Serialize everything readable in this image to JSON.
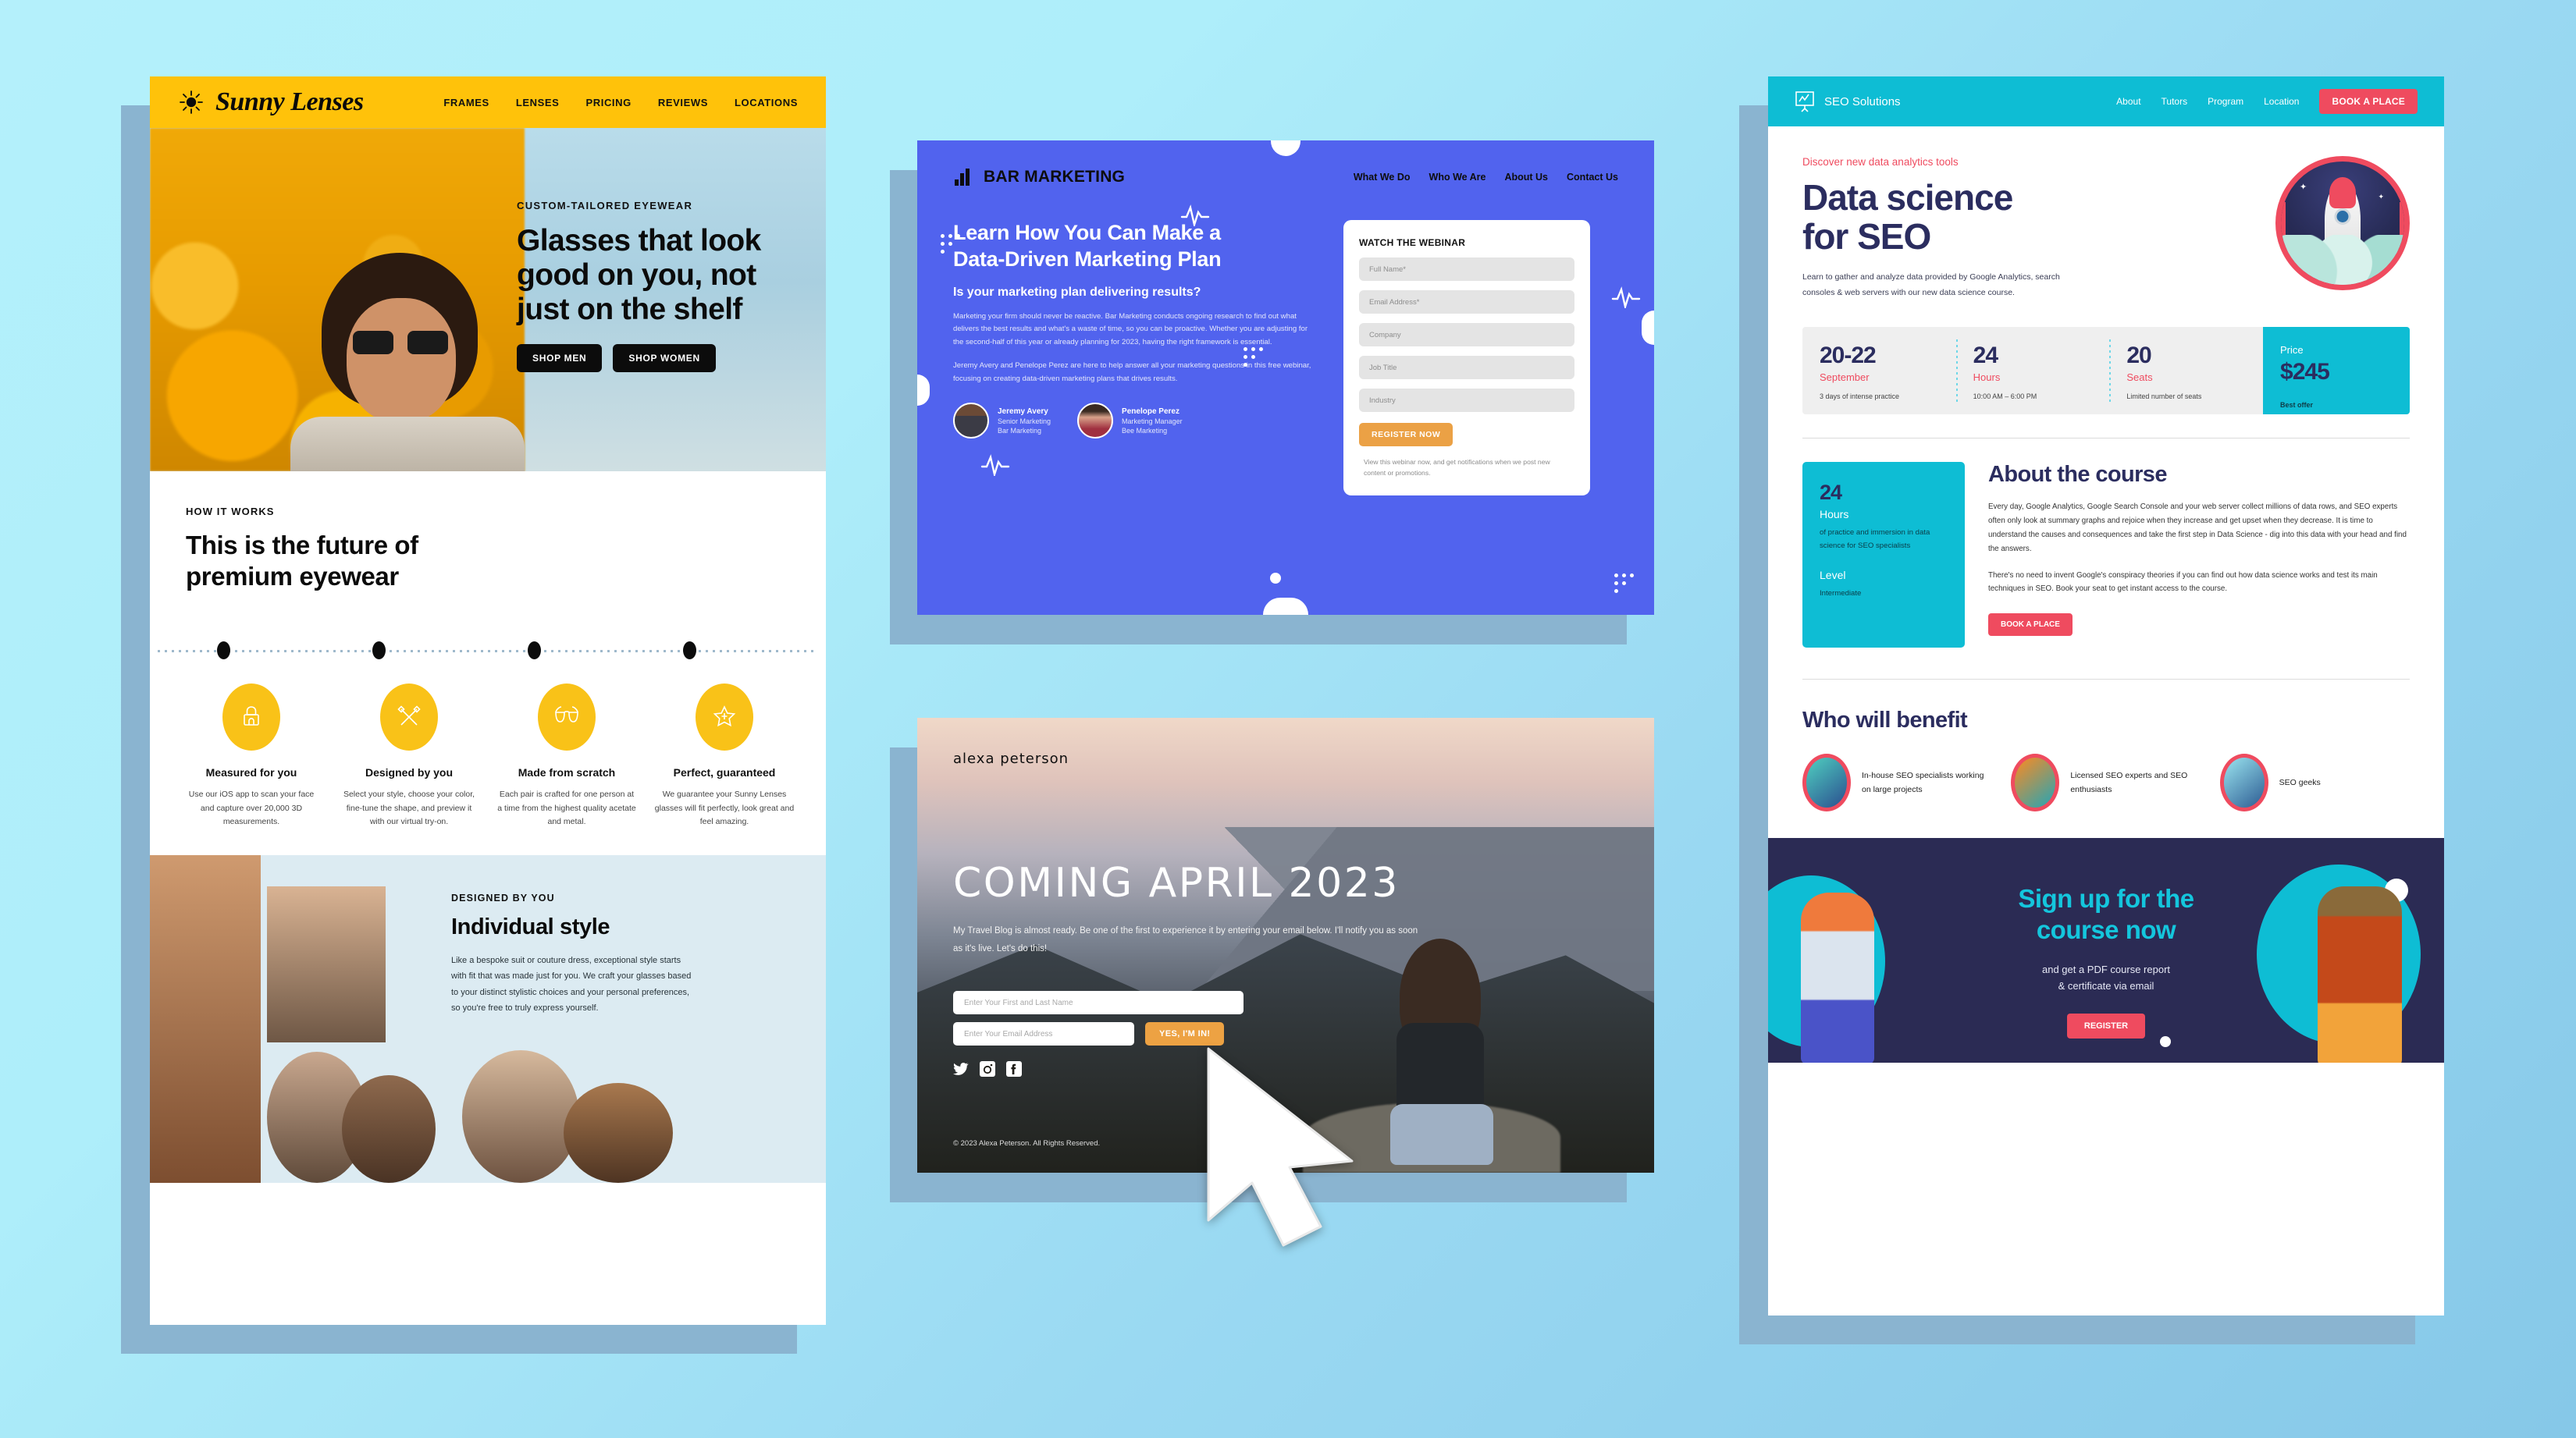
{
  "canvas": {
    "background_top": "#b4f0fb",
    "background_bottom": "#86c8e8",
    "shadow_color": "#8ab4d0"
  },
  "cursor": {
    "name": "mouse-cursor",
    "color": "#ffffff"
  },
  "sunny_lenses": {
    "accent": "#ffc20a",
    "brand": "Sunny Lenses",
    "nav": [
      "FRAMES",
      "LENSES",
      "PRICING",
      "REVIEWS",
      "LOCATIONS"
    ],
    "hero": {
      "kicker": "CUSTOM-TAILORED EYEWEAR",
      "heading_line1": "Glasses that look",
      "heading_line2": "good on you, not",
      "heading_line3": "just on the shelf",
      "buttons": [
        "SHOP MEN",
        "SHOP WOMEN"
      ]
    },
    "how": {
      "kicker": "HOW IT WORKS",
      "heading_line1": "This is the future of",
      "heading_line2": "premium eyewear",
      "features": [
        {
          "icon": "phone-scan-icon",
          "title": "Measured for you",
          "desc": "Use our iOS app to scan your face and capture over 20,000 3D measurements."
        },
        {
          "icon": "ruler-pencil-icon",
          "title": "Designed by you",
          "desc": "Select your style, choose your color, fine-tune the shape, and preview it with our virtual try-on."
        },
        {
          "icon": "glasses-icon",
          "title": "Made from scratch",
          "desc": "Each pair is crafted for one person at a time from the highest quality acetate and metal."
        },
        {
          "icon": "star-badge-icon",
          "title": "Perfect, guaranteed",
          "desc": "We guarantee your Sunny Lenses glasses will fit perfectly, look great and feel amazing."
        }
      ]
    },
    "style": {
      "kicker": "DESIGNED BY YOU",
      "heading": "Individual style",
      "body": "Like a bespoke suit or couture dress, exceptional style starts with fit that was made just for you. We craft your glasses based to your distinct stylistic choices and your personal preferences, so you're free to truly express yourself."
    }
  },
  "bar_marketing": {
    "accent": "#5163ee",
    "button_color": "#eba145",
    "brand": "BAR MARKETING",
    "nav": [
      "What We Do",
      "Who We Are",
      "About Us",
      "Contact Us"
    ],
    "heading_line1": "Learn How You Can Make a",
    "heading_line2": "Data-Driven Marketing Plan",
    "subheading": "Is your marketing plan delivering results?",
    "paragraph1": "Marketing your firm should never be reactive. Bar Marketing conducts ongoing research to find out what delivers the best results and what's a waste of time, so you can be proactive. Whether you are adjusting for the second-half of this year or already planning for 2023, having the right framework is essential.",
    "paragraph2": "Jeremy Avery and Penelope Perez are here to help answer all your marketing questions in this free webinar, focusing on creating data-driven marketing plans that drives results.",
    "speakers": [
      {
        "name": "Jeremy Avery",
        "role": "Senior Marketing",
        "company": "Bar Marketing"
      },
      {
        "name": "Penelope Perez",
        "role": "Marketing Manager",
        "company": "Bee Marketing"
      }
    ],
    "form": {
      "title": "WATCH THE WEBINAR",
      "fields": [
        "Full Name*",
        "Email Address*",
        "Company",
        "Job Title",
        "Industry"
      ],
      "submit": "REGISTER NOW",
      "note": "View this webinar now, and get notifications when we post new content or promotions."
    }
  },
  "alexa": {
    "accent": "#eda243",
    "brand": "alexa peterson",
    "heading": "COMING APRIL 2023",
    "paragraph": "My Travel Blog is almost ready. Be one of the first to experience it by entering your email below. I'll notify you as soon as it's live. Let's do this!",
    "name_placeholder": "Enter Your First and Last Name",
    "email_placeholder": "Enter Your Email Address",
    "submit": "YES, I'M IN!",
    "social": [
      "twitter-icon",
      "instagram-icon",
      "facebook-icon"
    ],
    "copyright": "© 2023 Alexa Peterson. All Rights Reserved."
  },
  "seo": {
    "accent": "#0ebdd4",
    "red": "#ef4b5f",
    "navy": "#2b2d5f",
    "brand": "SEO Solutions",
    "nav": [
      "About",
      "Tutors",
      "Program",
      "Location"
    ],
    "header_cta": "BOOK A PLACE",
    "hero": {
      "kicker": "Discover new data analytics tools",
      "heading_line1": "Data science",
      "heading_line2": "for SEO",
      "subtext": "Learn to gather and analyze data provided by Google Analytics, search consoles & web servers with our new data science course."
    },
    "stats": [
      {
        "number": "20-22",
        "label": "September",
        "desc": "3 days of intense practice"
      },
      {
        "number": "24",
        "label": "Hours",
        "desc": "10:00 AM – 6:00 PM"
      },
      {
        "number": "20",
        "label": "Seats",
        "desc": "Limited number of seats"
      }
    ],
    "price": {
      "label": "Price",
      "value": "$245",
      "desc": "Best offer"
    },
    "about": {
      "heading": "About the course",
      "paragraph1": "Every day, Google Analytics, Google Search Console and your web server collect millions of data rows, and SEO experts often only look at summary graphs and rejoice when they increase and get upset when they decrease. It is time to understand the causes and consequences and take the first step in Data Science - dig into this data with your head and find the answers.",
      "paragraph2": "There's no need to invent Google's conspiracy theories if you can find out how data science works and test its main techniques in SEO. Book your seat to get instant access to the course.",
      "button": "BOOK A PLACE",
      "info": {
        "number": "24",
        "label": "Hours",
        "desc": "of practice and immersion in data science for SEO specialists",
        "level_label": "Level",
        "level_value": "Intermediate"
      }
    },
    "benefit": {
      "heading": "Who will benefit",
      "items": [
        {
          "icon": "presenter-illustration",
          "text": "In-house SEO specialists working on large projects"
        },
        {
          "icon": "expert-illustration",
          "text": "Licensed SEO experts and SEO enthusiasts"
        },
        {
          "icon": "desk-worker-illustration",
          "text": "SEO geeks"
        }
      ]
    },
    "footer": {
      "heading_line1": "Sign up for the",
      "heading_line2": "course now",
      "sub_line1": "and get a PDF course report",
      "sub_line2": "& certificate via email",
      "button": "REGISTER"
    }
  }
}
